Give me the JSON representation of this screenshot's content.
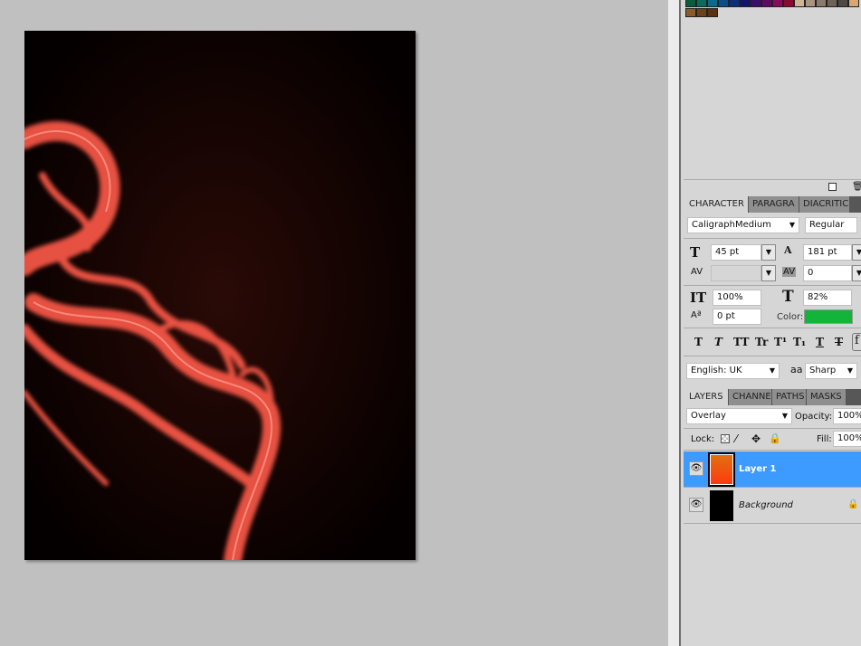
{
  "swatches": {
    "row1": [
      "#0b5c3a",
      "#0b6b5f",
      "#0b6a8a",
      "#0a4d8a",
      "#0a2f78",
      "#12146b",
      "#3a0e6b",
      "#5e0b63",
      "#8a0a5e",
      "#8a0a30",
      "#cdb596",
      "#a89480",
      "#8b7969",
      "#6f6259",
      "#4e4743",
      "#d7a874"
    ],
    "row2": [
      "#8b5a2b",
      "#6e4019",
      "#5a3211"
    ]
  },
  "character": {
    "tabs": [
      "CHARACTER",
      "PARAGRA",
      "DIACRITIC"
    ],
    "font_family": "CaligraphMedium",
    "font_style": "Regular",
    "font_size": "45 pt",
    "leading": "181 pt",
    "kerning": "",
    "tracking": "0",
    "vertical_scale": "100%",
    "horizontal_scale": "82%",
    "baseline_shift": "0 pt",
    "color_label": "Color:",
    "color": "#12b53a",
    "format_buttons": [
      "T",
      "T",
      "TT",
      "Tr",
      "T¹",
      "T₁",
      "T",
      "T"
    ],
    "language": "English: UK",
    "aa_label": "aa",
    "antialias": "Sharp"
  },
  "layers": {
    "tabs": [
      "LAYERS",
      "CHANNE",
      "PATHS",
      "MASKS"
    ],
    "blend_mode": "Overlay",
    "opacity_label": "Opacity:",
    "opacity": "100%",
    "lock_label": "Lock:",
    "fill_label": "Fill:",
    "fill": "100%",
    "items": [
      {
        "name": "Layer 1",
        "selected": true
      },
      {
        "name": "Background",
        "locked": true
      }
    ]
  }
}
